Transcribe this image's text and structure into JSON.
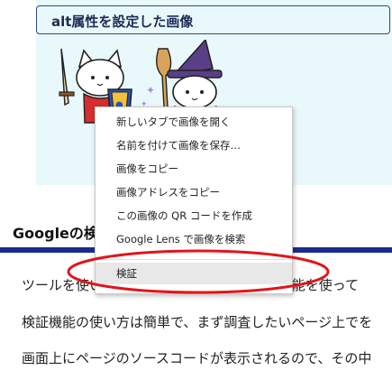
{
  "figure": {
    "heading": "alt属性を設定した画像"
  },
  "section": {
    "heading": "Googleの検"
  },
  "paragraphs": [
    "ツールを使い、「検証」で、Googleの検証機能を使って",
    "検証機能の使い方は簡単で、まず調査したいページ上でを",
    "画面上にページのソースコードが表示されるので、その中"
  ],
  "context_menu": {
    "items": [
      "新しいタブで画像を開く",
      "名前を付けて画像を保存…",
      "画像をコピー",
      "画像アドレスをコピー",
      "この画像の QR コードを作成",
      "Google Lens で画像を検索"
    ],
    "inspect": "検証"
  },
  "colors": {
    "figure_background": "#e9f9fb",
    "section_rule": "#1a2b8f",
    "annotation_ellipse": "#e0161b"
  },
  "icons": [
    "cat-knight-illustration",
    "cat-wizard-illustration"
  ]
}
